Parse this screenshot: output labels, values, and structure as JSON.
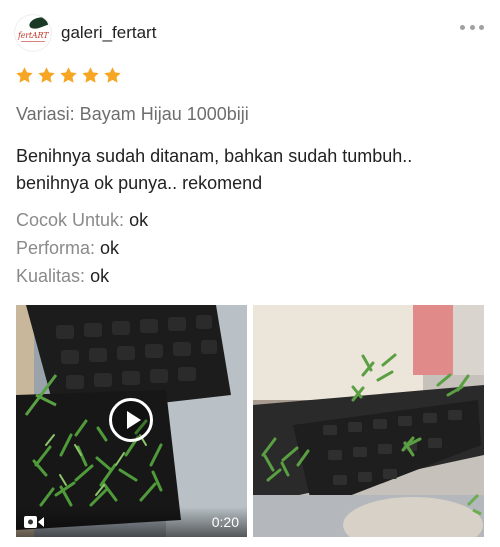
{
  "header": {
    "avatar_text": "fertART",
    "username": "galeri_fertart",
    "more_icon": "more-horizontal-icon"
  },
  "rating": {
    "stars": 5,
    "max": 5,
    "color": "#f6a623"
  },
  "variation": "Variasi: Bayam Hijau 1000biji",
  "review_text": "Benihnya sudah ditanam, bahkan sudah tumbuh.. benihnya ok punya.. rekomend",
  "attributes": [
    {
      "label": "Cocok Untuk:",
      "value": "ok"
    },
    {
      "label": "Performa:",
      "value": "ok"
    },
    {
      "label": "Kualitas:",
      "value": "ok"
    }
  ],
  "media": {
    "video": {
      "icon": "video-camera-icon",
      "duration": "0:20"
    },
    "photo": {
      "alt": "seedling-tray-photo"
    }
  }
}
